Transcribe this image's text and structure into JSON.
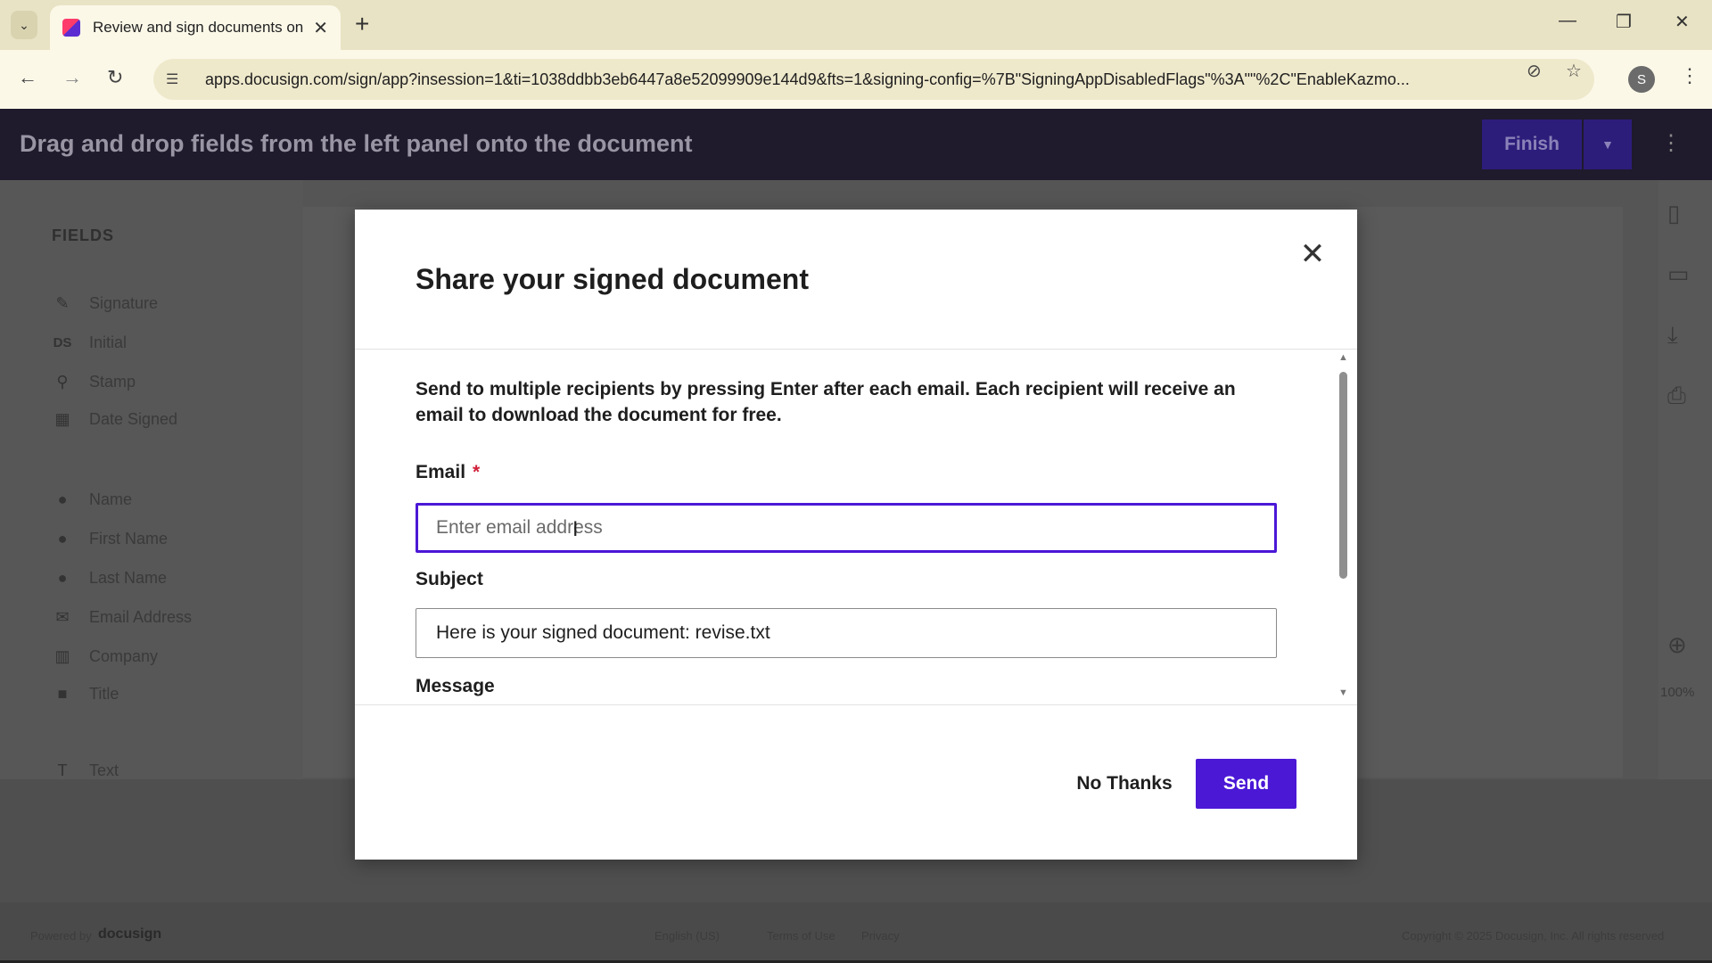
{
  "browser": {
    "tab_title": "Review and sign documents on",
    "url": "apps.docusign.com/sign/app?insession=1&ti=1038ddbb3eb6447a8e52099909e144d9&fts=1&signing-config=%7B\"SigningAppDisabledFlags\"%3A\"\"%2C\"EnableKazmo...",
    "profile_initial": "S"
  },
  "app": {
    "header_title": "Drag and drop fields from the left panel onto the document",
    "finish_label": "Finish",
    "sidebar_title": "FIELDS",
    "fields": [
      {
        "label": "Signature",
        "icon": "pen-icon"
      },
      {
        "label": "Initial",
        "icon": "initial-icon"
      },
      {
        "label": "Stamp",
        "icon": "stamp-icon"
      },
      {
        "label": "Date Signed",
        "icon": "calendar-icon"
      },
      {
        "label": "Name",
        "icon": "person-icon"
      },
      {
        "label": "First Name",
        "icon": "person-icon"
      },
      {
        "label": "Last Name",
        "icon": "person-icon"
      },
      {
        "label": "Email Address",
        "icon": "envelope-icon"
      },
      {
        "label": "Company",
        "icon": "building-icon"
      },
      {
        "label": "Title",
        "icon": "briefcase-icon"
      },
      {
        "label": "Text",
        "icon": "text-icon"
      }
    ],
    "initial_badge": "DS",
    "zoom_level": "100%",
    "footer": {
      "powered_by": "Powered by",
      "brand": "docusign",
      "language": "English (US)",
      "terms": "Terms of Use",
      "privacy": "Privacy",
      "copyright": "Copyright © 2025 Docusign, Inc. All rights reserved"
    }
  },
  "modal": {
    "title": "Share your signed document",
    "intro": "Send to multiple recipients by pressing Enter after each email. Each recipient will receive an email to download the document for free.",
    "email_label": "Email",
    "email_required_mark": "*",
    "email_placeholder": "Enter email address",
    "email_value": "",
    "subject_label": "Subject",
    "subject_value": "Here is your signed document: revise.txt",
    "message_label": "Message",
    "no_thanks_label": "No Thanks",
    "send_label": "Send"
  },
  "colors": {
    "accent": "#4b18d6",
    "required": "#d0213a"
  }
}
